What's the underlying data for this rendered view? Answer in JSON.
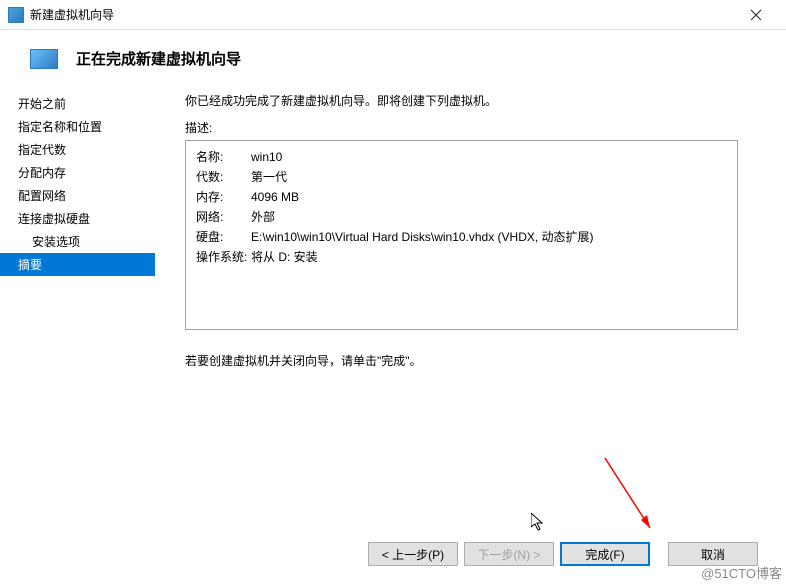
{
  "titlebar": {
    "title": "新建虚拟机向导"
  },
  "header": {
    "title": "正在完成新建虚拟机向导"
  },
  "sidebar": {
    "items": [
      {
        "label": "开始之前",
        "active": false,
        "indent": false
      },
      {
        "label": "指定名称和位置",
        "active": false,
        "indent": false
      },
      {
        "label": "指定代数",
        "active": false,
        "indent": false
      },
      {
        "label": "分配内存",
        "active": false,
        "indent": false
      },
      {
        "label": "配置网络",
        "active": false,
        "indent": false
      },
      {
        "label": "连接虚拟硬盘",
        "active": false,
        "indent": false
      },
      {
        "label": "安装选项",
        "active": false,
        "indent": true
      },
      {
        "label": "摘要",
        "active": true,
        "indent": false
      }
    ]
  },
  "main": {
    "intro": "你已经成功完成了新建虚拟机向导。即将创建下列虚拟机。",
    "desc_label": "描述:",
    "desc_rows": [
      {
        "key": "名称:",
        "val": "win10"
      },
      {
        "key": "代数:",
        "val": "第一代"
      },
      {
        "key": "内存:",
        "val": "4096 MB"
      },
      {
        "key": "网络:",
        "val": "外部"
      },
      {
        "key": "硬盘:",
        "val": "E:\\win10\\win10\\Virtual Hard Disks\\win10.vhdx (VHDX, 动态扩展)"
      },
      {
        "key": "操作系统:",
        "val": "将从 D: 安装"
      }
    ],
    "finish_hint": "若要创建虚拟机并关闭向导，请单击\"完成\"。"
  },
  "buttons": {
    "prev": "< 上一步(P)",
    "next": "下一步(N) >",
    "finish": "完成(F)",
    "cancel": "取消"
  },
  "watermark": "@51CTO博客"
}
